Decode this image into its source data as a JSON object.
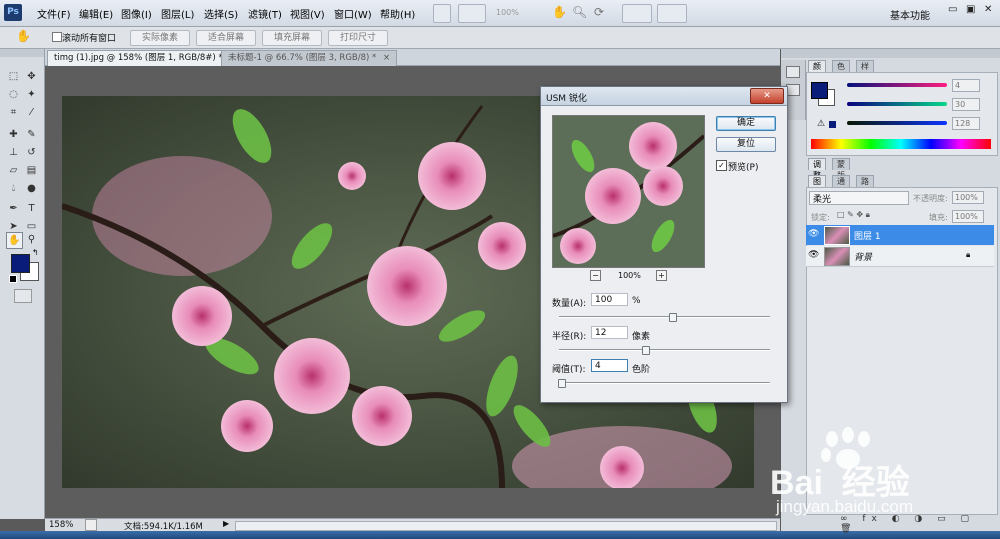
{
  "menubar": {
    "logo": "Ps",
    "items": [
      "文件(F)",
      "编辑(E)",
      "图像(I)",
      "图层(L)",
      "选择(S)",
      "滤镜(T)",
      "视图(V)",
      "窗口(W)",
      "帮助(H)"
    ],
    "zoom_display": "100%",
    "workspace": "基本功能",
    "window_controls": [
      "▭",
      "▣",
      "✕"
    ]
  },
  "optionsbar": {
    "scroll_all_label": "滚动所有窗口",
    "buttons": [
      "实际像素",
      "适合屏幕",
      "填充屏幕",
      "打印尺寸"
    ]
  },
  "tabs": [
    {
      "label": "timg (1).jpg @ 158% (图层 1, RGB/8#) *",
      "close": "×"
    },
    {
      "label": "未标题-1 @ 66.7% (图层 3, RGB/8) *",
      "close": "×"
    }
  ],
  "statusbar": {
    "zoom": "158%",
    "doc_info": "文档:594.1K/1.16M"
  },
  "color_panel": {
    "tabs": [
      "颜色",
      "色板",
      "样式"
    ],
    "values": [
      "4",
      "30",
      "128"
    ],
    "foreground": "#0a1c7a"
  },
  "adjust_panel": {
    "tabs": [
      "调整",
      "蒙版"
    ]
  },
  "layers_panel": {
    "tabs": [
      "图层",
      "通道",
      "路径"
    ],
    "blend_mode": "柔光",
    "opacity_label": "不透明度:",
    "opacity_value": "100%",
    "lock_label": "锁定:",
    "fill_label": "填充:",
    "fill_value": "100%",
    "layers": [
      {
        "name": "图层 1",
        "selected": true
      },
      {
        "name": "背景",
        "selected": false
      }
    ]
  },
  "dialog": {
    "title": "USM 锐化",
    "ok_label": "确定",
    "reset_label": "复位",
    "preview_label": "预览(P)",
    "preview_checked": true,
    "zoom_value": "100%",
    "zoom_out": "−",
    "zoom_in": "+",
    "amount_label": "数量(A):",
    "amount_value": "100",
    "amount_unit": "%",
    "radius_label": "半径(R):",
    "radius_value": "12",
    "radius_unit": "像素",
    "threshold_label": "阈值(T):",
    "threshold_value": "4",
    "threshold_unit": "色阶"
  },
  "watermark": {
    "brand": "Bai  经验",
    "url": "jingyan.baidu.com"
  }
}
